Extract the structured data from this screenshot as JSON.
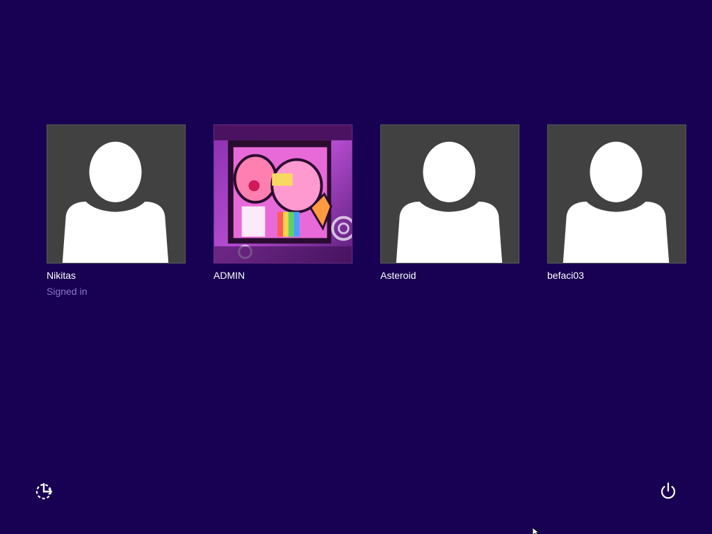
{
  "background_color": "#180052",
  "users": [
    {
      "name": "Nikitas",
      "status": "Signed in",
      "avatar": "default-user-silhouette"
    },
    {
      "name": "ADMIN",
      "status": "",
      "avatar": "photo"
    },
    {
      "name": "Asteroid",
      "status": "",
      "avatar": "default-user-silhouette"
    },
    {
      "name": "befaci03",
      "status": "",
      "avatar": "default-user-silhouette"
    }
  ],
  "bottom_bar": {
    "ease_of_access_icon": "ease-of-access-icon",
    "power_icon": "power-icon"
  },
  "colors": {
    "tile_bg": "#414141",
    "name_text": "#ffffff",
    "status_text": "#8c78c8"
  }
}
